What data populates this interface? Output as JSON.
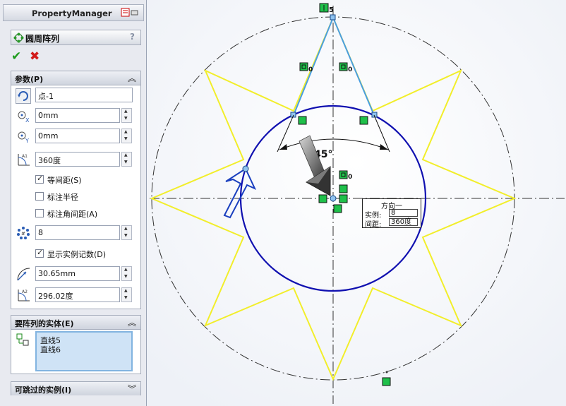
{
  "pm": {
    "title": "PropertyManager",
    "feature_title": "圆周阵列",
    "help_label": "?",
    "ok_label": "✔",
    "cancel_label": "✖"
  },
  "params": {
    "header": "参数(P)",
    "center_point": "点-1",
    "x_value": "0mm",
    "y_value": "0mm",
    "angle_value": "360度",
    "equal_spacing_label": "等间距(S)",
    "equal_spacing_checked": true,
    "dim_radius_label": "标注半径",
    "dim_radius_checked": false,
    "dim_angle_label": "标注角间距(A)",
    "dim_angle_checked": false,
    "instances": "8",
    "show_count_label": "显示实例记数(D)",
    "show_count_checked": true,
    "radius_value": "30.65mm",
    "arc_angle_value": "296.02度"
  },
  "entities": {
    "header": "要阵列的实体(E)",
    "items": [
      "直线5",
      "直线6"
    ]
  },
  "skip": {
    "header": "可跳过的实例(I)"
  },
  "canvas": {
    "top_label": "5",
    "angle_label": "45°",
    "relation_zero": "0",
    "callout_title": "方向一",
    "callout_instances_key": "实例:",
    "callout_instances_val": "8",
    "callout_spacing_key": "间距:",
    "callout_spacing_val": "360度"
  },
  "colors": {
    "sketch_blue": "#1010b0",
    "star_yellow": "#f2ee2a",
    "selected_cyan": "#4a9ee0",
    "relation_green": "#1fc04a"
  }
}
